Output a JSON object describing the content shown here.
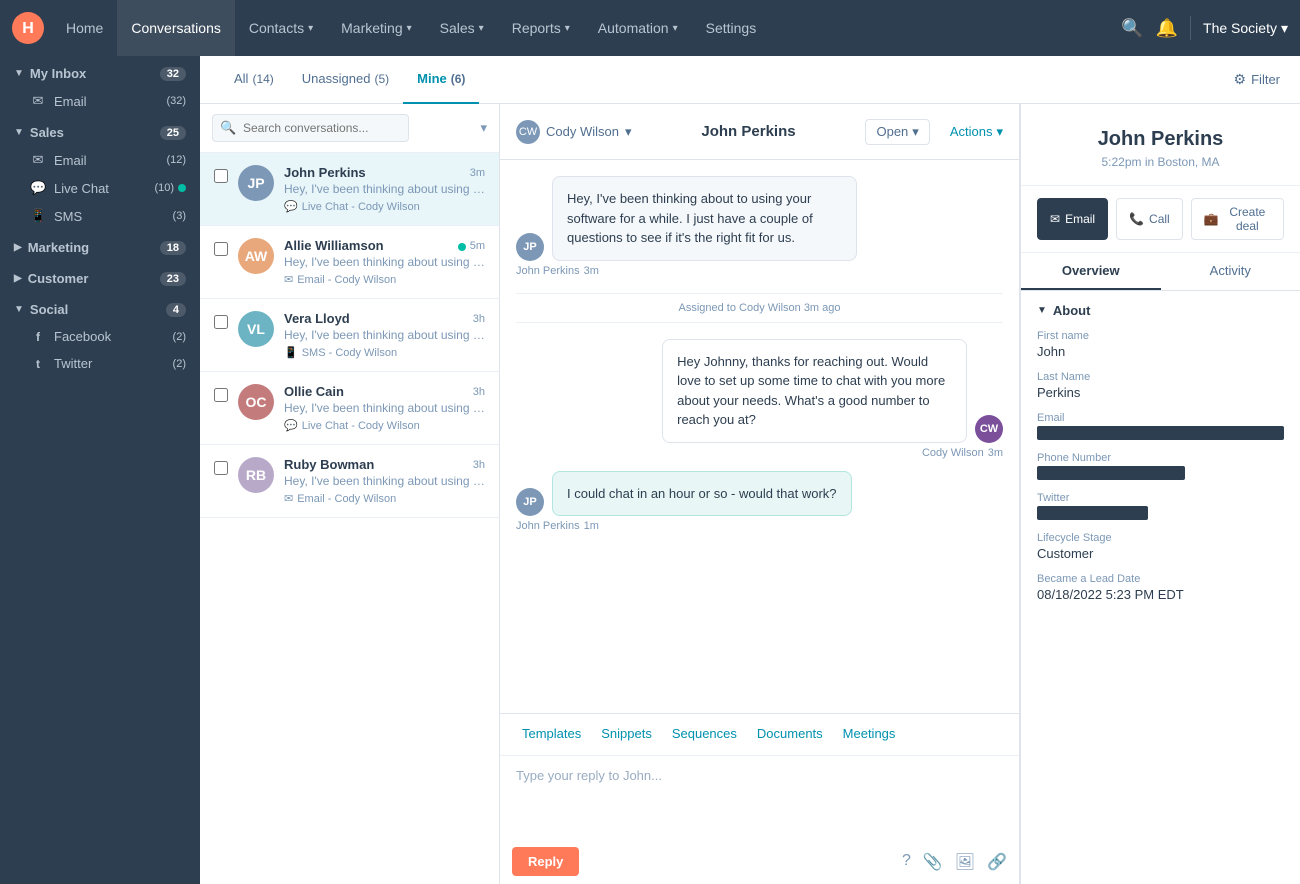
{
  "topnav": {
    "logo_text": "H",
    "items": [
      {
        "label": "Home",
        "active": false,
        "has_chevron": false
      },
      {
        "label": "Conversations",
        "active": true,
        "has_chevron": false
      },
      {
        "label": "Contacts",
        "active": false,
        "has_chevron": true
      },
      {
        "label": "Marketing",
        "active": false,
        "has_chevron": true
      },
      {
        "label": "Sales",
        "active": false,
        "has_chevron": true
      },
      {
        "label": "Reports",
        "active": false,
        "has_chevron": true
      },
      {
        "label": "Automation",
        "active": false,
        "has_chevron": true
      },
      {
        "label": "Settings",
        "active": false,
        "has_chevron": false
      }
    ],
    "org_name": "The Society"
  },
  "sidebar": {
    "sections": [
      {
        "label": "My Inbox",
        "badge": "32",
        "expanded": true,
        "items": [
          {
            "icon": "✉",
            "label": "Email",
            "badge": "(32)"
          }
        ]
      },
      {
        "label": "Sales",
        "badge": "25",
        "expanded": true,
        "items": [
          {
            "icon": "✉",
            "label": "Email",
            "badge": "(12)",
            "has_dot": false
          },
          {
            "icon": "💬",
            "label": "Live Chat",
            "badge": "(10)",
            "has_dot": true
          },
          {
            "icon": "📱",
            "label": "SMS",
            "badge": "(3)",
            "has_dot": false
          }
        ]
      },
      {
        "label": "Marketing",
        "badge": "18",
        "expanded": false,
        "items": []
      },
      {
        "label": "Customer",
        "badge": "23",
        "expanded": false,
        "items": []
      },
      {
        "label": "Social",
        "badge": "4",
        "expanded": true,
        "items": [
          {
            "icon": "f",
            "label": "Facebook",
            "badge": "(2)",
            "has_dot": false
          },
          {
            "icon": "t",
            "label": "Twitter",
            "badge": "(2)",
            "has_dot": false
          }
        ]
      }
    ]
  },
  "tabs": {
    "all": {
      "label": "All",
      "count": "(14)"
    },
    "unassigned": {
      "label": "Unassigned",
      "count": "(5)"
    },
    "mine": {
      "label": "Mine",
      "count": "(6)"
    },
    "filter": "Filter"
  },
  "search": {
    "placeholder": "Search conversations..."
  },
  "conversations": [
    {
      "name": "John Perkins",
      "time": "3m",
      "preview": "Hey, I've been thinking about using your software for a while. I just ha...",
      "channel": "Live Chat - Cody Wilson",
      "channel_icon": "💬",
      "avatar_color": "#7c98b6",
      "initials": "JP",
      "selected": true,
      "unread_dot": false
    },
    {
      "name": "Allie Williamson",
      "time": "5m",
      "preview": "Hey, I've been thinking about using your software for a while. I just ha...",
      "channel": "Email - Cody Wilson",
      "channel_icon": "✉",
      "avatar_color": "#e8a87c",
      "initials": "AW",
      "selected": false,
      "unread_dot": true
    },
    {
      "name": "Vera Lloyd",
      "time": "3h",
      "preview": "Hey, I've been thinking about using your software for a while. I just ha...",
      "channel": "SMS - Cody Wilson",
      "channel_icon": "📱",
      "avatar_color": "#6cb4c4",
      "initials": "VL",
      "selected": false,
      "unread_dot": false
    },
    {
      "name": "Ollie Cain",
      "time": "3h",
      "preview": "Hey, I've been thinking about using your software for a while. I just ha...",
      "channel": "Live Chat - Cody Wilson",
      "channel_icon": "💬",
      "avatar_color": "#c47b7b",
      "initials": "OC",
      "selected": false,
      "unread_dot": false
    },
    {
      "name": "Ruby Bowman",
      "time": "3h",
      "preview": "Hey, I've been thinking about using your software for a while. I just ha...",
      "channel": "Email - Cody Wilson",
      "channel_icon": "✉",
      "avatar_color": "#b8a9c9",
      "initials": "RB",
      "selected": false,
      "unread_dot": false
    }
  ],
  "conv_header": {
    "assigned_user": "Cody Wilson",
    "contact_name": "John Perkins",
    "status": "Open",
    "actions": "Actions"
  },
  "messages": [
    {
      "type": "incoming",
      "text": "Hey, I've been thinking about to using your software for a while. I just have a couple of questions to see if it's the right fit for us.",
      "sender": "John Perkins",
      "time": "3m",
      "avatar_color": "#7c98b6",
      "initials": "JP"
    },
    {
      "type": "divider",
      "text": "Assigned to Cody Wilson 3m ago"
    },
    {
      "type": "outgoing",
      "text": "Hey Johnny, thanks for reaching out. Would love to set up some time to chat with you more about your needs. What's a good number to reach you at?",
      "sender": "Cody Wilson",
      "time": "3m",
      "avatar_color": "#7c4f9a",
      "initials": "CW"
    },
    {
      "type": "incoming",
      "text": "I could chat in an hour or so - would that work?",
      "sender": "John Perkins",
      "time": "1m",
      "avatar_color": "#7c98b6",
      "initials": "JP"
    }
  ],
  "reply_area": {
    "tabs": [
      "Templates",
      "Snippets",
      "Sequences",
      "Documents",
      "Meetings"
    ],
    "placeholder": "Type your reply to John...",
    "reply_button": "Reply"
  },
  "right_panel": {
    "contact_name": "John Perkins",
    "location": "5:22pm in Boston, MA",
    "actions": {
      "email": "Email",
      "call": "Call",
      "create_deal": "Create deal"
    },
    "overview_tab": "Overview",
    "activity_tab": "Activity",
    "about": {
      "header": "About",
      "fields": [
        {
          "label": "First name",
          "value": "John",
          "redacted": false
        },
        {
          "label": "Last Name",
          "value": "Perkins",
          "redacted": false
        },
        {
          "label": "Email",
          "value": "",
          "redacted": true
        },
        {
          "label": "Phone Number",
          "value": "",
          "redacted": true
        },
        {
          "label": "Twitter",
          "value": "",
          "redacted": true,
          "small": true
        },
        {
          "label": "Lifecycle Stage",
          "value": "Customer",
          "redacted": false
        },
        {
          "label": "Became a Lead Date",
          "value": "08/18/2022 5:23 PM EDT",
          "redacted": false
        }
      ]
    }
  }
}
